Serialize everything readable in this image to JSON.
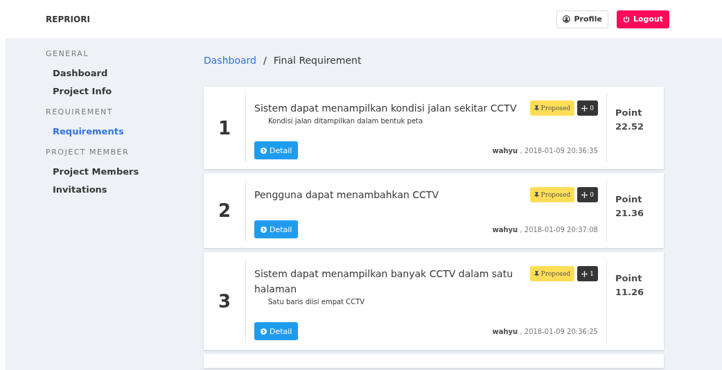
{
  "navbar": {
    "brand": "REPRIORI",
    "buttons": [
      {
        "label": "Profile",
        "kind": "profile"
      },
      {
        "label": "Logout",
        "kind": "logout"
      }
    ]
  },
  "sidebar": {
    "sections": [
      {
        "heading": "GENERAL",
        "items": [
          {
            "label": "Dashboard",
            "selected": false
          },
          {
            "label": "Project Info",
            "selected": false
          }
        ]
      },
      {
        "heading": "REQUIREMENT",
        "items": [
          {
            "label": "Requirements",
            "selected": true
          }
        ]
      },
      {
        "heading": "PROJECT MEMBER",
        "items": [
          {
            "label": "Project Members",
            "selected": false
          },
          {
            "label": "Invitations",
            "selected": false
          }
        ]
      }
    ]
  },
  "breadcrumb": [
    {
      "label": "Dashboard",
      "kind": "link"
    },
    {
      "label": "/",
      "kind": "separator"
    },
    {
      "label": "Final Requirement",
      "kind": "current"
    }
  ],
  "requirements": [
    {
      "number": "1",
      "title": "Sistem dapat menampilkan kondisi jalan sekitar CCTV",
      "description": "Kondisi jalan ditampilkan dalam bentuk peta",
      "status": "Proposed",
      "votes": "0",
      "button": "Detail",
      "author": "wahyu",
      "timestamp": ", 2018-01-09 20:36:35",
      "point_label": "Point",
      "point": "22.52"
    },
    {
      "number": "2",
      "title": "Pengguna dapat menambahkan CCTV",
      "status": "Proposed",
      "votes": "0",
      "button": "Detail",
      "author": "wahyu",
      "timestamp": ", 2018-01-09 20:37:08",
      "point_label": "Point",
      "point": "21.36"
    },
    {
      "number": "3",
      "title": "Sistem dapat menampilkan banyak CCTV dalam satu halaman",
      "description": "Satu baris diisi empat CCTV",
      "status": "Proposed",
      "votes": "1",
      "button": "Detail",
      "author": "wahyu",
      "timestamp": ", 2018-01-09 20:36:25",
      "point_label": "Point",
      "point": "11.26"
    }
  ]
}
